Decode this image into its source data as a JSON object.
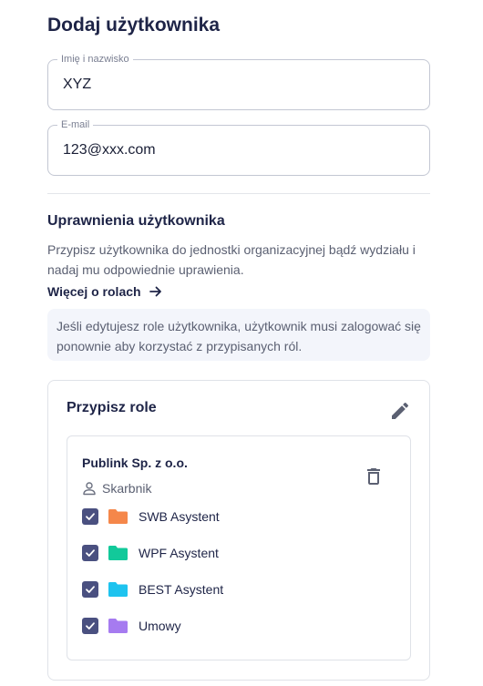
{
  "page": {
    "title": "Dodaj użytkownika"
  },
  "form": {
    "name": {
      "label": "Imię i nazwisko",
      "value": "XYZ"
    },
    "email": {
      "label": "E-mail",
      "value": "123@xxx.com"
    }
  },
  "permissions": {
    "title": "Uprawnienia użytkownika",
    "description": "Przypisz użytkownika do jednostki organizacyjnej bądź wydziału i nadaj mu odpowiednie uprawienia.",
    "link": "Więcej o rolach",
    "info": "Jeśli edytujesz role użytkownika, użytkownik musi zalogować się ponownie aby korzystać z przypisanych ról."
  },
  "roles_card": {
    "title": "Przypisz role",
    "organization": "Publink Sp. z o.o.",
    "role": "Skarbnik",
    "items": [
      {
        "label": "SWB Asystent",
        "color": "#f5874a",
        "checked": true
      },
      {
        "label": "WPF Asystent",
        "color": "#12c99a",
        "checked": true
      },
      {
        "label": "BEST Asystent",
        "color": "#1ec3ef",
        "checked": true
      },
      {
        "label": "Umowy",
        "color": "#a67bf0",
        "checked": true
      }
    ]
  },
  "colors": {
    "primary": "#1e2447",
    "checkbox": "#4a5080",
    "border": "#c3c7d3",
    "info_bg": "#f3f5fb"
  }
}
